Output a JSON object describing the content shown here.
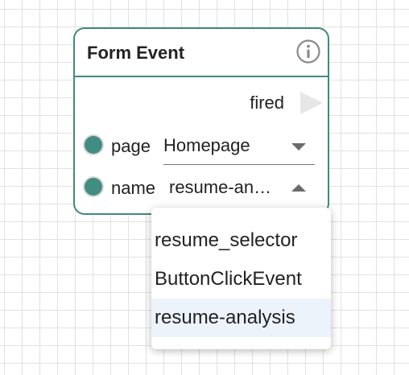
{
  "node": {
    "title": "Form Event",
    "info_icon": "info-circle-icon",
    "output": {
      "label": "fired",
      "icon": "play-triangle-icon"
    },
    "fields": {
      "page": {
        "label": "page",
        "value": "Homepage",
        "caret_icon": "caret-down-icon"
      },
      "name": {
        "label": "name",
        "value": "resume-analysis",
        "caret_icon": "caret-up-icon"
      }
    }
  },
  "dropdown": {
    "options": [
      "resume_selector",
      "ButtonClickEvent",
      "resume-analysis"
    ],
    "selected": "resume-analysis"
  },
  "colors": {
    "node_border": "#3f8a80",
    "port": "#428d81",
    "focus_underline": "#2f6fd6",
    "selected_option_bg": "#edf3fb"
  }
}
